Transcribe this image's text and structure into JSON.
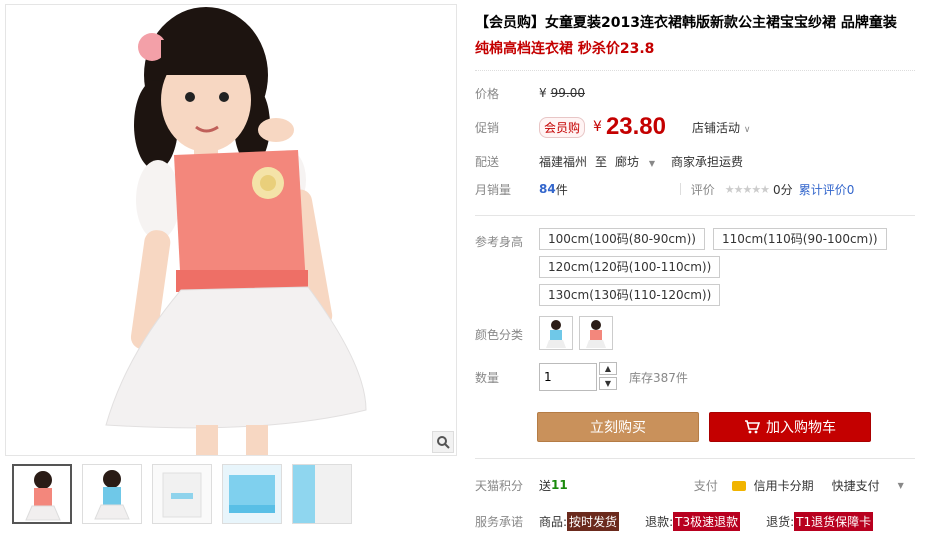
{
  "product": {
    "title": "【会员购】女童夏装2013连衣裙韩版新款公主裙宝宝纱裙 品牌童装",
    "subtitle": "纯棉高档连衣裙 秒杀价23.8"
  },
  "price": {
    "label": "价格",
    "currency": "¥",
    "original": "99.00"
  },
  "promo": {
    "label": "促销",
    "badge": "会员购",
    "currency": "¥",
    "price": "23.80",
    "activity": "店铺活动"
  },
  "delivery": {
    "label": "配送",
    "from": "福建福州",
    "to_word": "至",
    "to": "廊坊",
    "shipping": "商家承担运费"
  },
  "sales": {
    "label": "月销量",
    "count": "84",
    "unit": "件",
    "rating_label": "评价",
    "score": "0分",
    "reviews_link": "累计评价0"
  },
  "height": {
    "label": "参考身高",
    "options": [
      "100cm(100码(80-90cm))",
      "110cm(110码(90-100cm))",
      "120cm(120码(100-110cm))",
      "130cm(130码(110-120cm))"
    ]
  },
  "color": {
    "label": "颜色分类",
    "options": [
      "blue",
      "pink"
    ]
  },
  "quantity": {
    "label": "数量",
    "value": "1",
    "stock": "库存387件"
  },
  "actions": {
    "buy_now": "立刻购买",
    "add_cart": "加入购物车"
  },
  "points": {
    "label": "天猫积分",
    "send": "送",
    "value": "11",
    "pay_label": "支付",
    "credit": "信用卡分期",
    "quick_pay": "快捷支付"
  },
  "service": {
    "label": "服务承诺",
    "goods": "商品:",
    "goods_tag": "按时发货",
    "refund": "退款:",
    "refund_tag": "T3极速退款",
    "return": "退货:",
    "return_tag": "T1退货保障卡"
  },
  "colors": {
    "accent": "#c40000",
    "buy_button": "#c9915b",
    "link": "#3366cc"
  }
}
